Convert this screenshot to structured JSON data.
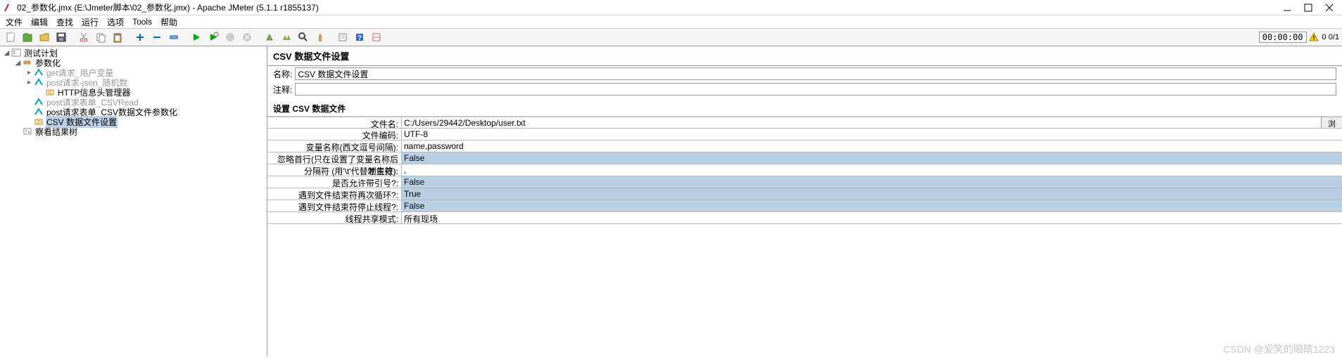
{
  "title": "02_参数化.jmx (E:\\Jmeter脚本\\02_参数化.jmx) - Apache JMeter (5.1.1 r1855137)",
  "menu": [
    "文件",
    "编辑",
    "查找",
    "运行",
    "选项",
    "Tools",
    "帮助"
  ],
  "timer": "00:00:00",
  "status_count": "0 0/1",
  "tree": {
    "root": "测试计划",
    "group": "参数化",
    "items": [
      {
        "label": "get请求_用户变量",
        "dim": true
      },
      {
        "label": "post请求-json_随机数",
        "dim": true
      },
      {
        "label": "HTTP信息头管理器",
        "dim": false
      },
      {
        "label": "post请求表单_CSVRead",
        "dim": true
      },
      {
        "label": "post请求表单_CSV数据文件参数化",
        "dim": false
      },
      {
        "label": "CSV 数据文件设置",
        "dim": false,
        "selected": true
      }
    ],
    "results": "察看结果树"
  },
  "panel": {
    "title": "CSV 数据文件设置",
    "name_label": "名称:",
    "name_value": "CSV 数据文件设置",
    "comment_label": "注释:",
    "comment_value": "",
    "section": "设置 CSV 数据文件",
    "rows": [
      {
        "label": "文件名:",
        "value": "C:/Users/29442/Desktop/user.txt",
        "browse": "浏览.."
      },
      {
        "label": "文件编码:",
        "value": "UTF-8"
      },
      {
        "label": "变量名称(西文逗号间隔):",
        "value": "name,password"
      },
      {
        "label": "忽略首行(只在设置了变量名称后才生效):",
        "value": "False",
        "hl": true
      },
      {
        "label": "分隔符 (用'\\t'代替制表符):",
        "value": ","
      },
      {
        "label": "是否允许带引号?:",
        "value": "False",
        "hl": true
      },
      {
        "label": "遇到文件结束符再次循环?:",
        "value": "True",
        "hl": true
      },
      {
        "label": "遇到文件结束符停止线程?:",
        "value": "False",
        "hl": true
      },
      {
        "label": "线程共享模式:",
        "value": "所有现场"
      }
    ]
  },
  "watermark": "CSDN @爱笑的眼睛1223"
}
